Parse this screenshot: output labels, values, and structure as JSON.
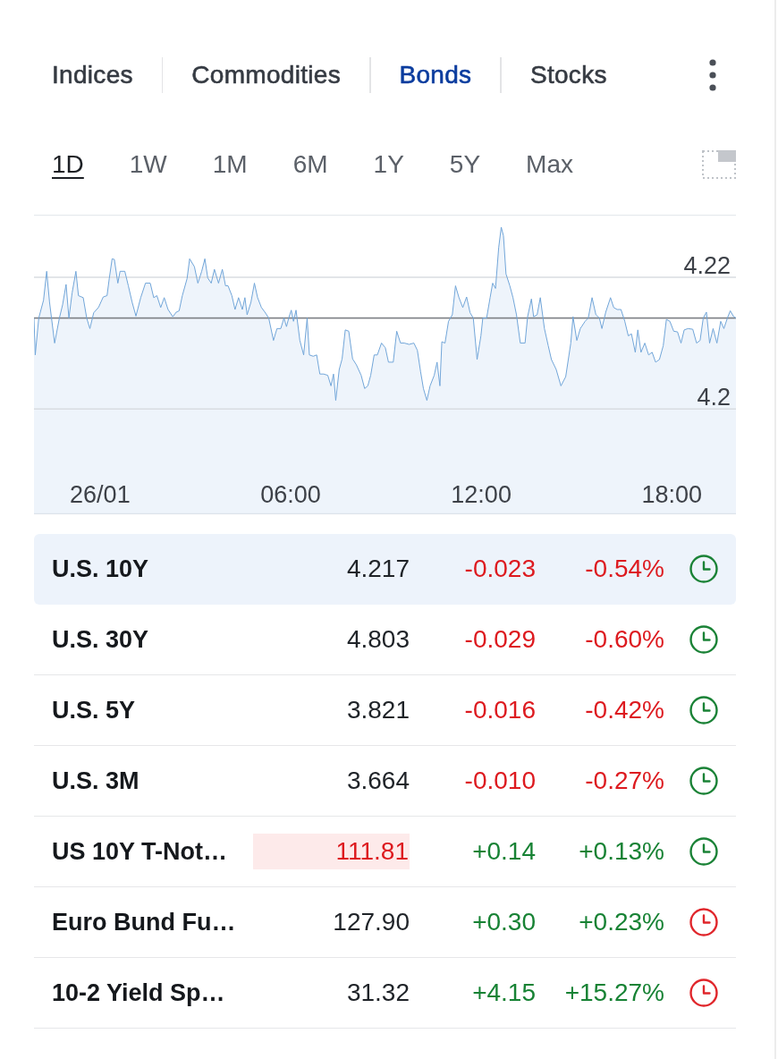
{
  "tabs": [
    {
      "label": "Indices",
      "selected": false
    },
    {
      "label": "Commodities",
      "selected": false
    },
    {
      "label": "Bonds",
      "selected": true
    },
    {
      "label": "Stocks",
      "selected": false
    }
  ],
  "ranges": [
    {
      "label": "1D",
      "selected": true
    },
    {
      "label": "1W",
      "selected": false
    },
    {
      "label": "1M",
      "selected": false
    },
    {
      "label": "6M",
      "selected": false
    },
    {
      "label": "1Y",
      "selected": false
    },
    {
      "label": "5Y",
      "selected": false
    },
    {
      "label": "Max",
      "selected": false
    }
  ],
  "chart": {
    "chart_data": {
      "type": "area",
      "x": [
        -2.08,
        -2.04,
        -1.93,
        -1.78,
        -1.68,
        -1.59,
        -1.43,
        -1.28,
        -1.18,
        -1.07,
        -0.98,
        -0.88,
        -0.76,
        -0.68,
        -0.53,
        -0.42,
        -0.32,
        -0.2,
        -0.05,
        0.1,
        0.22,
        0.29,
        0.38,
        0.45,
        0.56,
        0.63,
        0.78,
        0.89,
        1.01,
        1.13,
        1.28,
        1.43,
        1.58,
        1.69,
        1.79,
        1.91,
        2.02,
        2.14,
        2.29,
        2.4,
        2.49,
        2.59,
        2.74,
        2.82,
        2.97,
        3.08,
        3.2,
        3.3,
        3.39,
        3.5,
        3.6,
        3.73,
        3.85,
        3.95,
        4.03,
        4.15,
        4.25,
        4.36,
        4.48,
        4.56,
        4.63,
        4.75,
        4.86,
        4.96,
        5.08,
        5.19,
        5.31,
        5.46,
        5.57,
        5.69,
        5.79,
        5.87,
        5.94,
        6.02,
        6.09,
        6.17,
        6.29,
        6.41,
        6.52,
        6.59,
        6.71,
        6.82,
        6.92,
        7.04,
        7.17,
        7.27,
        7.35,
        7.42,
        7.53,
        7.62,
        7.72,
        7.83,
        7.95,
        8.07,
        8.22,
        8.33,
        8.43,
        8.52,
        8.63,
        8.73,
        8.86,
        8.98,
        9.08,
        9.23,
        9.34,
        9.46,
        9.58,
        9.73,
        9.88,
        9.99,
        10.09,
        10.18,
        10.29,
        10.39,
        10.52,
        10.61,
        10.7,
        10.76,
        10.86,
        10.97,
        11.09,
        11.19,
        11.3,
        11.42,
        11.54,
        11.65,
        11.75,
        11.87,
        11.99,
        12.05,
        12.17,
        12.28,
        12.36,
        12.45,
        12.55,
        12.63,
        12.7,
        12.78,
        12.9,
        13.0,
        13.11,
        13.23,
        13.38,
        13.46,
        13.58,
        13.65,
        13.76,
        13.86,
        13.99,
        14.11,
        14.21,
        14.36,
        14.51,
        14.66,
        14.82,
        14.89,
        15.01,
        15.12,
        15.27,
        15.37,
        15.49,
        15.61,
        15.72,
        15.8,
        15.92,
        16.07,
        16.17,
        16.28,
        16.4,
        16.52,
        16.63,
        16.73,
        16.85,
        16.93,
        17.03,
        17.15,
        17.27,
        17.38,
        17.49,
        17.61,
        17.73,
        17.83,
        17.94,
        18.06,
        18.18,
        18.29,
        18.39,
        18.51,
        18.66,
        18.78,
        18.89,
        18.99,
        19.09,
        19.19,
        19.3,
        19.42,
        19.54,
        19.64,
        19.75,
        19.84,
        19.95,
        20.02
      ],
      "series": [
        {
          "color": "#72a6d9",
          "values": [
            4.2138,
            4.2082,
            4.2138,
            4.2165,
            4.2209,
            4.2162,
            4.21,
            4.2138,
            4.2158,
            4.2189,
            4.2138,
            4.2176,
            4.2209,
            4.2172,
            4.2169,
            4.2138,
            4.2122,
            4.2146,
            4.2154,
            4.217,
            4.2172,
            4.2198,
            4.2228,
            4.2227,
            4.2191,
            4.2209,
            4.2209,
            4.2187,
            4.2162,
            4.2141,
            4.2169,
            4.2191,
            4.2191,
            4.2169,
            4.2172,
            4.2154,
            4.2169,
            4.2151,
            4.214,
            4.2147,
            4.2149,
            4.2172,
            4.2198,
            4.2228,
            4.2216,
            4.2191,
            4.2209,
            4.2228,
            4.2199,
            4.2191,
            4.2212,
            4.2191,
            4.2212,
            4.2187,
            4.2187,
            4.2172,
            4.2151,
            4.2169,
            4.2151,
            4.2169,
            4.2143,
            4.2162,
            4.2191,
            4.2169,
            4.2154,
            4.2147,
            4.2138,
            4.2104,
            4.2122,
            4.2122,
            4.2138,
            4.2125,
            4.2138,
            4.215,
            4.2133,
            4.215,
            4.2104,
            4.2082,
            4.2138,
            4.2082,
            4.208,
            4.2082,
            4.2053,
            4.2053,
            4.2051,
            4.2035,
            4.2053,
            4.2013,
            4.206,
            4.2076,
            4.212,
            4.2118,
            4.2076,
            4.2067,
            4.2051,
            4.2031,
            4.2035,
            4.2051,
            4.2082,
            4.2082,
            4.21,
            4.2093,
            4.2071,
            4.2071,
            4.2118,
            4.21,
            4.21,
            4.2098,
            4.21,
            4.2089,
            4.2057,
            4.2031,
            4.2013,
            4.2035,
            4.2051,
            4.2071,
            4.2035,
            4.2102,
            4.21,
            4.2133,
            4.2143,
            4.2187,
            4.2169,
            4.2154,
            4.217,
            4.2146,
            4.2138,
            4.2075,
            4.2111,
            4.2138,
            4.2138,
            4.2169,
            4.2191,
            4.2183,
            4.2245,
            4.2276,
            4.2263,
            4.2205,
            4.2187,
            4.2169,
            4.2143,
            4.21,
            4.21,
            4.214,
            4.2167,
            4.214,
            4.2143,
            4.2169,
            4.2122,
            4.2096,
            4.2075,
            4.206,
            4.2035,
            4.2049,
            4.21,
            4.214,
            4.2104,
            4.2122,
            4.2133,
            4.2138,
            4.2169,
            4.2143,
            4.2138,
            4.2122,
            4.2147,
            4.2169,
            4.2154,
            4.2151,
            4.2151,
            4.2133,
            4.2111,
            4.2114,
            4.2086,
            4.212,
            4.2086,
            4.21,
            4.2082,
            4.2086,
            4.2071,
            4.2075,
            4.2096,
            4.2136,
            4.2133,
            4.2118,
            4.2117,
            4.21,
            4.212,
            4.2122,
            4.2121,
            4.21,
            4.2104,
            4.2138,
            4.2147,
            4.21,
            4.2122,
            4.21,
            4.2133,
            4.2122,
            4.2138,
            4.2149,
            4.214,
            4.2138
          ]
        }
      ],
      "xlim": [
        -2.08,
        20.02
      ],
      "ylim": [
        4.184,
        4.2295
      ],
      "xticks": [
        {
          "value": 0,
          "label": "26/01"
        },
        {
          "value": 6,
          "label": "06:00"
        },
        {
          "value": 12,
          "label": "12:00"
        },
        {
          "value": 18,
          "label": "18:00"
        }
      ],
      "yticks": [
        4.2,
        4.22
      ],
      "ref_lines": [
        {
          "axis": "y",
          "value": 4.2138
        }
      ]
    }
  },
  "rows": [
    {
      "name": "U.S. 10Y",
      "price": "4.217",
      "change": "-0.023",
      "change_percent": "-0.54%",
      "rising": false,
      "price_highlighted": false,
      "market_open": true,
      "selected": true
    },
    {
      "name": "U.S. 30Y",
      "price": "4.803",
      "change": "-0.029",
      "change_percent": "-0.60%",
      "rising": false,
      "price_highlighted": false,
      "market_open": true,
      "selected": false
    },
    {
      "name": "U.S. 5Y",
      "price": "3.821",
      "change": "-0.016",
      "change_percent": "-0.42%",
      "rising": false,
      "price_highlighted": false,
      "market_open": true,
      "selected": false
    },
    {
      "name": "U.S. 3M",
      "price": "3.664",
      "change": "-0.010",
      "change_percent": "-0.27%",
      "rising": false,
      "price_highlighted": false,
      "market_open": true,
      "selected": false
    },
    {
      "name": "US 10Y T-Not…",
      "price": "111.81",
      "change": "+0.14",
      "change_percent": "+0.13%",
      "rising": true,
      "price_highlighted": true,
      "market_open": true,
      "selected": false
    },
    {
      "name": "Euro Bund Fu…",
      "price": "127.90",
      "change": "+0.30",
      "change_percent": "+0.23%",
      "rising": true,
      "price_highlighted": false,
      "market_open": false,
      "selected": false
    },
    {
      "name": "10-2 Yield Sp…",
      "price": "31.32",
      "change": "+4.15",
      "change_percent": "+15.27%",
      "rising": true,
      "price_highlighted": false,
      "market_open": false,
      "selected": false
    }
  ]
}
